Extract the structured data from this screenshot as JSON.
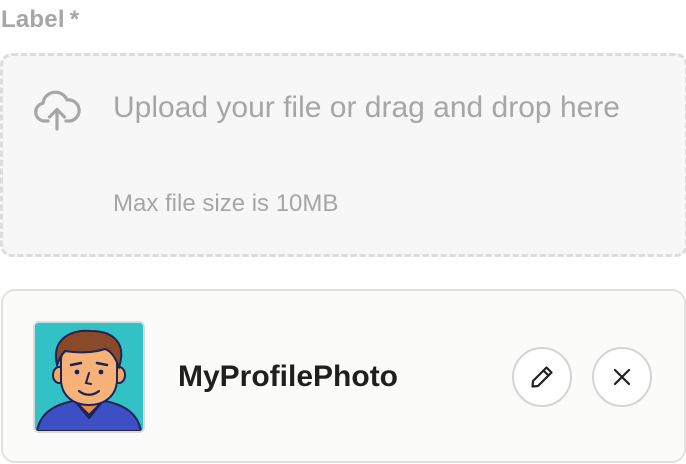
{
  "field": {
    "label": "Label",
    "required_marker": "*"
  },
  "dropzone": {
    "prompt": "Upload your file or drag and drop here",
    "hint": "Max file size is 10MB",
    "icon": "cloud-upload-icon"
  },
  "file": {
    "name": "MyProfilePhoto",
    "thumbnail": "avatar-illustration",
    "edit_icon": "pencil-icon",
    "remove_icon": "close-icon"
  },
  "colors": {
    "muted_text": "#a6a6a6",
    "dropzone_bg": "#f7f7f7",
    "dropzone_border": "#dcdcdc",
    "card_border": "#e2e2e2",
    "thumb_bg": "#32c1c4",
    "name_text": "#1f1f1f"
  }
}
